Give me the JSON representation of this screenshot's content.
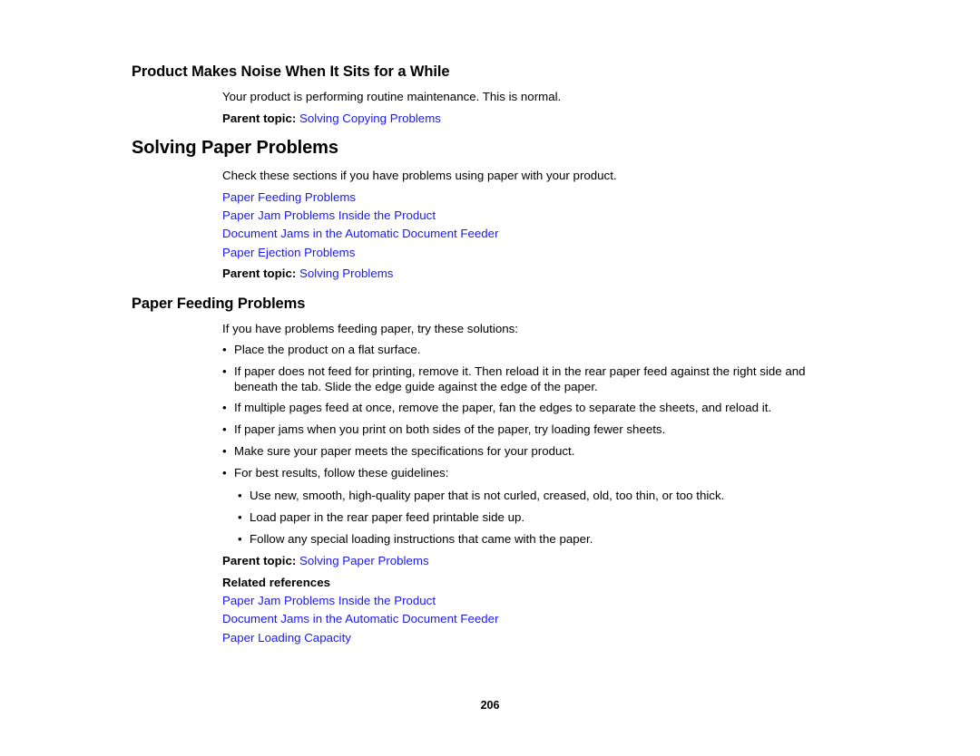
{
  "page": {
    "number": "206"
  },
  "sections": {
    "noise": {
      "heading": "Product Makes Noise When It Sits for a While",
      "paragraph": "Your product is performing routine maintenance. This is normal.",
      "parent_topic_label": "Parent topic:",
      "parent_topic_link": "Solving Copying Problems"
    },
    "solving_paper_problems": {
      "heading": "Solving Paper Problems",
      "paragraph": "Check these sections if you have problems using paper with your product.",
      "links": [
        "Paper Feeding Problems",
        "Paper Jam Problems Inside the Product",
        "Document Jams in the Automatic Document Feeder",
        "Paper Ejection Problems"
      ],
      "parent_topic_label": "Parent topic:",
      "parent_topic_link": "Solving Problems"
    },
    "paper_feeding_problems": {
      "heading": "Paper Feeding Problems",
      "intro": "If you have problems feeding paper, try these solutions:",
      "bullet_marker": "•",
      "bullets": [
        "Place the product on a flat surface.",
        "If paper does not feed for printing, remove it. Then reload it in the rear paper feed against the right side and beneath the tab. Slide the edge guide against the edge of the paper.",
        "If multiple pages feed at once, remove the paper, fan the edges to separate the sheets, and reload it.",
        "If paper jams when you print on both sides of the paper, try loading fewer sheets.",
        "Make sure your paper meets the specifications for your product.",
        "For best results, follow these guidelines:"
      ],
      "sub_bullets": [
        "Use new, smooth, high-quality paper that is not curled, creased, old, too thin, or too thick.",
        "Load paper in the rear paper feed printable side up.",
        "Follow any special loading instructions that came with the paper."
      ],
      "parent_topic_label": "Parent topic:",
      "parent_topic_link": "Solving Paper Problems",
      "related_references_label": "Related references",
      "related_references": [
        "Paper Jam Problems Inside the Product",
        "Document Jams in the Automatic Document Feeder",
        "Paper Loading Capacity"
      ]
    }
  }
}
